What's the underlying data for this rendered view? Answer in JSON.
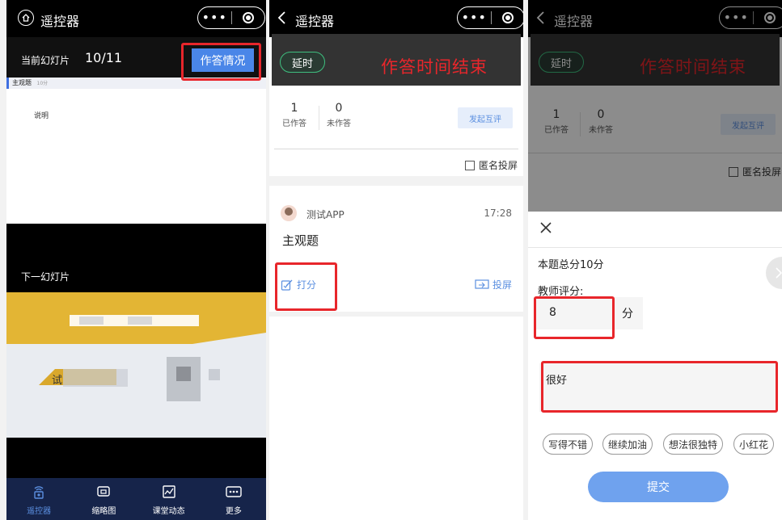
{
  "panel1": {
    "nav": {
      "title": "遥控器"
    },
    "slide_bar": {
      "label": "当前幻灯片",
      "counter": "10/11",
      "status_button": "作答情况"
    },
    "slide": {
      "question_tag": "主观题",
      "question_score": "10分",
      "description": "说明"
    },
    "next_slide_label": "下一幻灯片",
    "thumb_text": "试",
    "tabs": [
      {
        "label": "遥控器",
        "icon": "remote-icon"
      },
      {
        "label": "缩略图",
        "icon": "thumbnail-icon"
      },
      {
        "label": "课堂动态",
        "icon": "activity-chart-icon"
      },
      {
        "label": "更多",
        "icon": "more-icon"
      }
    ]
  },
  "panel2": {
    "nav": {
      "title": "遥控器"
    },
    "banner": {
      "extend_button": "延时",
      "end_text": "作答时间结束"
    },
    "stats": [
      {
        "value": "1",
        "label": "已作答"
      },
      {
        "value": "0",
        "label": "未作答"
      }
    ],
    "peer_review_button": "发起互评",
    "anonymous_label": "匿名投屏",
    "answer": {
      "user": "测试APP",
      "time": "17:28",
      "question": "主观题",
      "grade_label": "打分",
      "project_label": "投屏"
    }
  },
  "panel3": {
    "nav": {
      "title": "遥控器"
    },
    "banner": {
      "extend_button": "延时",
      "end_text": "作答时间结束"
    },
    "stats": [
      {
        "value": "1",
        "label": "已作答"
      },
      {
        "value": "0",
        "label": "未作答"
      }
    ],
    "peer_review_button": "发起互评",
    "anonymous_label": "匿名投屏",
    "sheet": {
      "close_icon": "close-icon",
      "total_score": "本题总分10分",
      "teacher_score_label": "教师评分:",
      "score_value": "8",
      "score_unit": "分",
      "comment_value": "很好",
      "quick_comments": [
        "写得不错",
        "继续加油",
        "想法很独特",
        "小红花"
      ],
      "submit_label": "提交"
    }
  },
  "colors": {
    "accent_blue": "#5b8fe0",
    "end_red": "#e8262b",
    "extend_green": "#3fbf7f",
    "tabbar_navy": "#16244a"
  }
}
